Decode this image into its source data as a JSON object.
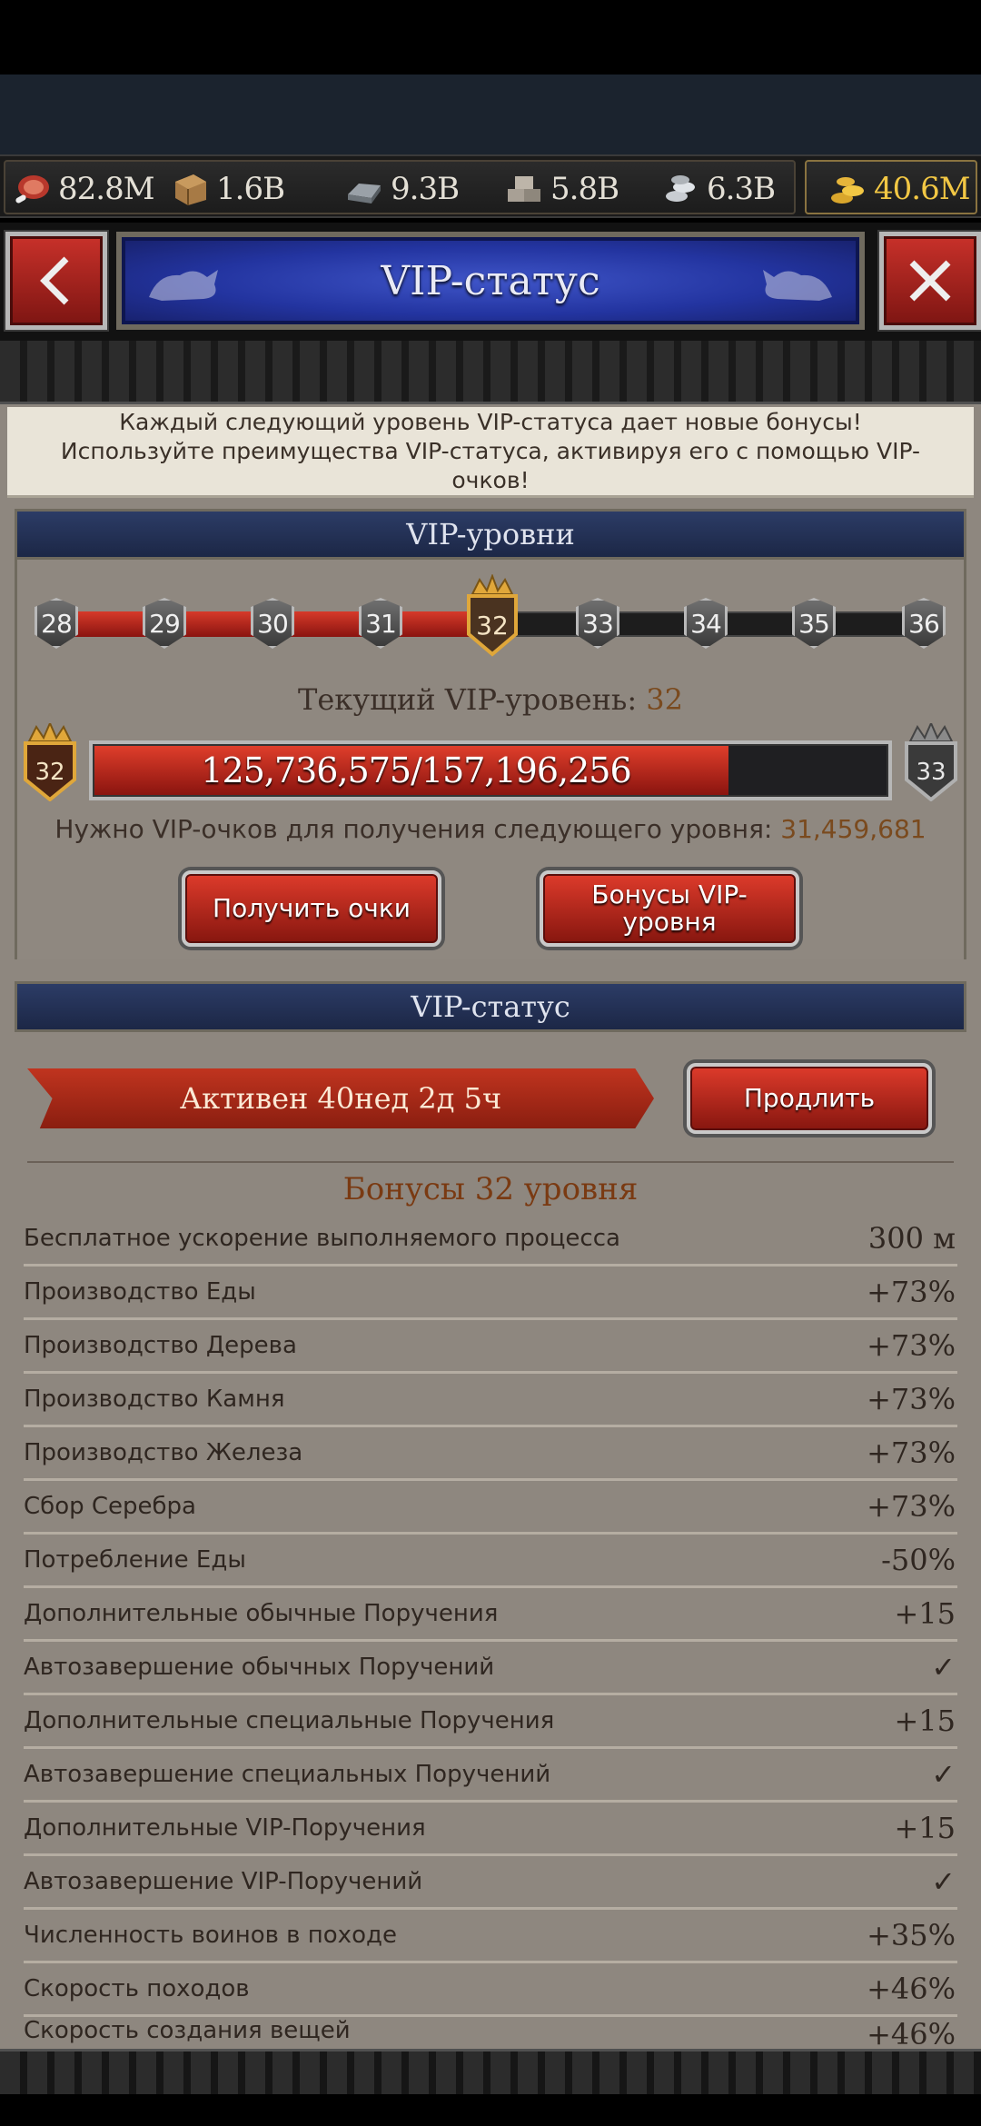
{
  "resources": {
    "food": "82.8M",
    "wood": "1.6B",
    "iron": "9.3B",
    "stone": "5.8B",
    "silver": "6.3B",
    "gold": "40.6M"
  },
  "header": {
    "title": "VIP-статус"
  },
  "intro": "Каждый следующий уровень VIP-статуса дает новые бонусы! Используйте преимущества VIP-статуса, активируя его с помощью VIP-очков!",
  "levels_section": {
    "title": "VIP-уровни",
    "nodes": [
      "28",
      "29",
      "30",
      "31",
      "32",
      "33",
      "34",
      "35",
      "36"
    ],
    "current_label": "Текущий VIP-уровень:",
    "current_value": "32",
    "current_shield": "32",
    "next_shield": "33",
    "points_text": "125,736,575/157,196,256",
    "progress": 0.8,
    "need_label": "Нужно VIP-очков для получения следующего уровня:",
    "need_value": "31,459,681",
    "get_points_button": "Получить очки",
    "bonuses_button": "Бонусы VIP-уровня"
  },
  "status_section": {
    "title": "VIP-статус",
    "active_text": "Активен 40нед 2д 5ч",
    "extend_button": "Продлить",
    "bonus_title": "Бонусы 32 уровня",
    "bonuses": [
      {
        "name": "Бесплатное ускорение выполняемого процесса",
        "value": "300 м"
      },
      {
        "name": "Производство Еды",
        "value": "+73%"
      },
      {
        "name": "Производство Дерева",
        "value": "+73%"
      },
      {
        "name": "Производство Камня",
        "value": "+73%"
      },
      {
        "name": "Производство Железа",
        "value": "+73%"
      },
      {
        "name": "Сбор Серебра",
        "value": "+73%"
      },
      {
        "name": "Потребление Еды",
        "value": "-50%"
      },
      {
        "name": "Дополнительные обычные Поручения",
        "value": "+15"
      },
      {
        "name": "Автозавершение обычных Поручений",
        "value": "✓"
      },
      {
        "name": "Дополнительные специальные Поручения",
        "value": "+15"
      },
      {
        "name": "Автозавершение специальных Поручений",
        "value": "✓"
      },
      {
        "name": "Дополнительные VIP-Поручения",
        "value": "+15"
      },
      {
        "name": "Автозавершение VIP-Поручений",
        "value": "✓"
      },
      {
        "name": "Численность воинов в походе",
        "value": "+35%"
      },
      {
        "name": "Скорость походов",
        "value": "+46%"
      },
      {
        "name": "Скорость создания вещей",
        "value": "+46%"
      }
    ]
  }
}
